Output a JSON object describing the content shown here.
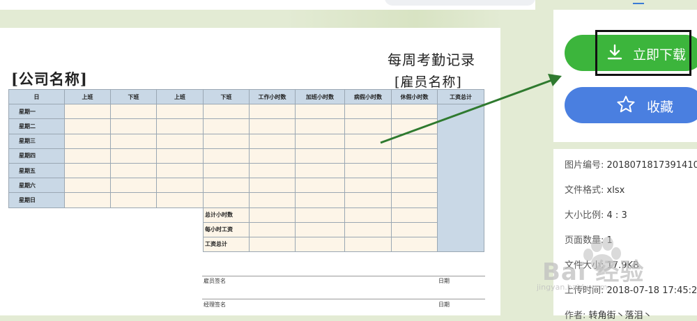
{
  "document": {
    "title": "每周考勤记录",
    "company": "[公司名称]",
    "employee": "[雇员名称]",
    "columns": [
      "日",
      "上班",
      "下班",
      "上班",
      "下班",
      "工作小时数",
      "加班小时数",
      "病假小时数",
      "休假小时数",
      "工资总计"
    ],
    "days": [
      "星期一",
      "星期二",
      "星期三",
      "星期四",
      "星期五",
      "星期六",
      "星期日"
    ],
    "summary": [
      "总计小时数",
      "每小时工资",
      "工资总计"
    ],
    "signature_employee": "雇员签名",
    "signature_manager": "经理签名",
    "date_label": "日期"
  },
  "panel": {
    "download_label": "立即下载",
    "favorite_label": "收藏",
    "info": [
      {
        "key": "图片编号:",
        "value": "2018071817391410"
      },
      {
        "key": "文件格式:",
        "value": "xlsx"
      },
      {
        "key": "大小比例:",
        "value": "4 : 3"
      },
      {
        "key": "页面数量:",
        "value": "1"
      },
      {
        "key": "文件大小:",
        "value": "17.9KB"
      },
      {
        "key": "上传时间:",
        "value": "2018-07-18 17:45:2"
      },
      {
        "key": "作者:",
        "value": "转角街丶落泪丶"
      }
    ]
  },
  "watermark": {
    "brand": "Bai 经验",
    "url": "jingyan.baidu.com"
  },
  "colors": {
    "download": "#3cb53c",
    "favorite": "#4a7fe0",
    "arrow": "#2f7a2f",
    "header_fill": "#c9d8e6",
    "cell_fill": "#fdf5e8"
  }
}
